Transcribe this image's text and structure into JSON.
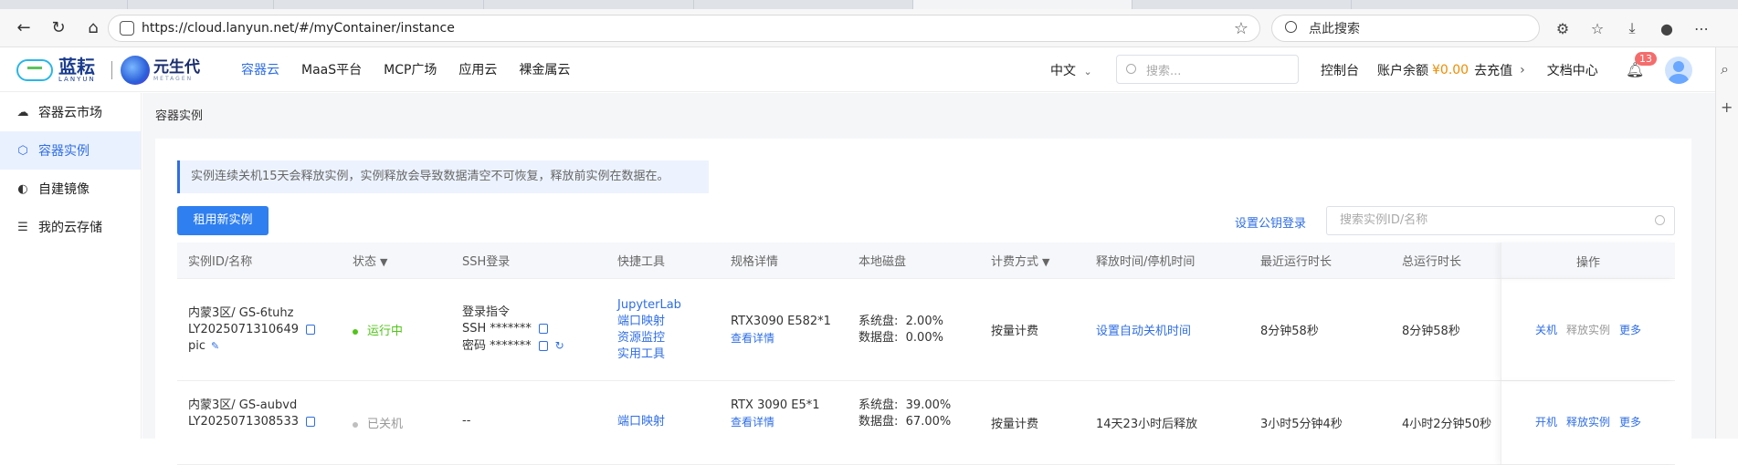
{
  "browser": {
    "url": "https://cloud.lanyun.net/#/myContainer/instance",
    "search_placeholder": "点此搜索"
  },
  "header": {
    "logo1_text": "蓝耘",
    "logo1_sub": "LANYUN",
    "logo2_text": "元生代",
    "logo2_sub": "METAGEN",
    "nav": [
      {
        "label": "容器云",
        "active": true
      },
      {
        "label": "MaaS平台"
      },
      {
        "label": "MCP广场"
      },
      {
        "label": "应用云"
      },
      {
        "label": "裸金属云"
      }
    ],
    "language": "中文",
    "search_placeholder": "搜索...",
    "console": "控制台",
    "balance_label": "账户余额",
    "balance_value": "¥0.00",
    "recharge": "去充值",
    "docs": "文档中心",
    "notification_count": "13"
  },
  "sidebar": {
    "items": [
      {
        "label": "容器云市场",
        "icon": "cloud-icon"
      },
      {
        "label": "容器实例",
        "icon": "hexagon-icon",
        "active": true
      },
      {
        "label": "自建镜像",
        "icon": "image-icon"
      },
      {
        "label": "我的云存储",
        "icon": "storage-icon"
      }
    ]
  },
  "main": {
    "breadcrumb": "容器实例",
    "alert": "实例连续关机15天会释放实例，实例释放会导致数据清空不可恢复，释放前实例在数据在。",
    "new_instance_button": "租用新实例",
    "set_pubkey": "设置公钥登录",
    "table_search_placeholder": "搜索实例ID/名称",
    "columns": [
      "实例ID/名称",
      "状态",
      "SSH登录",
      "快捷工具",
      "规格详情",
      "本地磁盘",
      "计费方式",
      "释放时间/停机时间",
      "最近运行时长",
      "总运行时长",
      "操作"
    ],
    "rows": [
      {
        "region": "内蒙3区/ GS-6tuhz",
        "id": "LY2025071310649",
        "name": "pic",
        "status": "运行中",
        "status_color": "#52c41a",
        "ssh_label": "登录指令",
        "ssh_cmd": "SSH *******",
        "ssh_pwd": "密码 *******",
        "tools": [
          "JupyterLab",
          "端口映射",
          "资源监控",
          "实用工具"
        ],
        "spec": "RTX3090 E582*1",
        "spec_link": "查看详情",
        "disk_sys_label": "系统盘:",
        "disk_sys": "2.00%",
        "disk_data_label": "数据盘:",
        "disk_data": "0.00%",
        "billing": "按量计费",
        "release": "设置自动关机时间",
        "recent": "8分钟58秒",
        "total": "8分钟58秒",
        "ops": [
          "关机",
          "释放实例",
          "更多"
        ]
      },
      {
        "region": "内蒙3区/ GS-aubvd",
        "id": "LY2025071308533",
        "status": "已关机",
        "status_color": "#bfbfbf",
        "ssh_empty": "--",
        "tools": [
          "端口映射"
        ],
        "spec": "RTX 3090 E5*1",
        "spec_link": "查看详情",
        "disk_sys_label": "系统盘:",
        "disk_sys": "39.00%",
        "disk_data_label": "数据盘:",
        "disk_data": "67.00%",
        "billing": "按量计费",
        "release": "14天23小时后释放",
        "recent": "3小时5分钟4秒",
        "total": "4小时2分钟50秒",
        "ops": [
          "开机",
          "释放实例",
          "更多"
        ]
      }
    ]
  }
}
